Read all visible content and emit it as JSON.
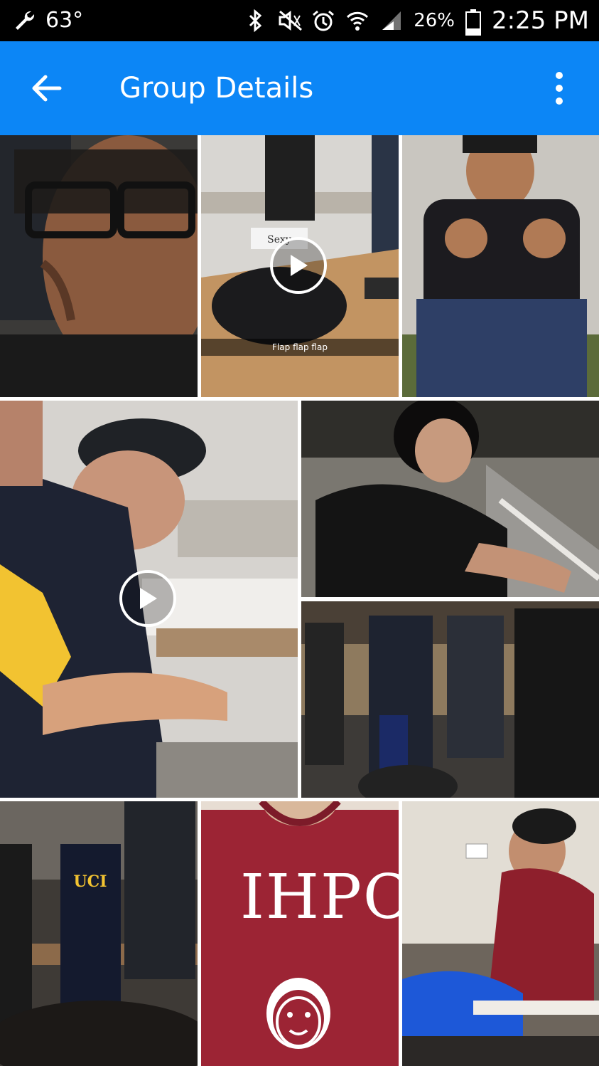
{
  "status_bar": {
    "temperature": "63°",
    "battery_percent": "26%",
    "time": "2:25 PM",
    "icons": [
      "wrench-icon",
      "bluetooth-icon",
      "mute-icon",
      "alarm-icon",
      "wifi-icon",
      "signal-icon",
      "battery-icon"
    ]
  },
  "app_bar": {
    "title": "Group Details",
    "background": "#0c86f6",
    "back_icon": "arrow-left-icon",
    "menu_icon": "more-vertical-icon"
  },
  "media": [
    {
      "kind": "photo"
    },
    {
      "kind": "video",
      "caption": "Flap flap flap",
      "sign_text": "Sexy"
    },
    {
      "kind": "photo"
    },
    {
      "kind": "video"
    },
    {
      "kind": "photo"
    },
    {
      "kind": "photo"
    },
    {
      "kind": "photo",
      "shirt_text": "UCI"
    },
    {
      "kind": "photo",
      "shirt_text": "IHPC"
    },
    {
      "kind": "photo"
    }
  ]
}
